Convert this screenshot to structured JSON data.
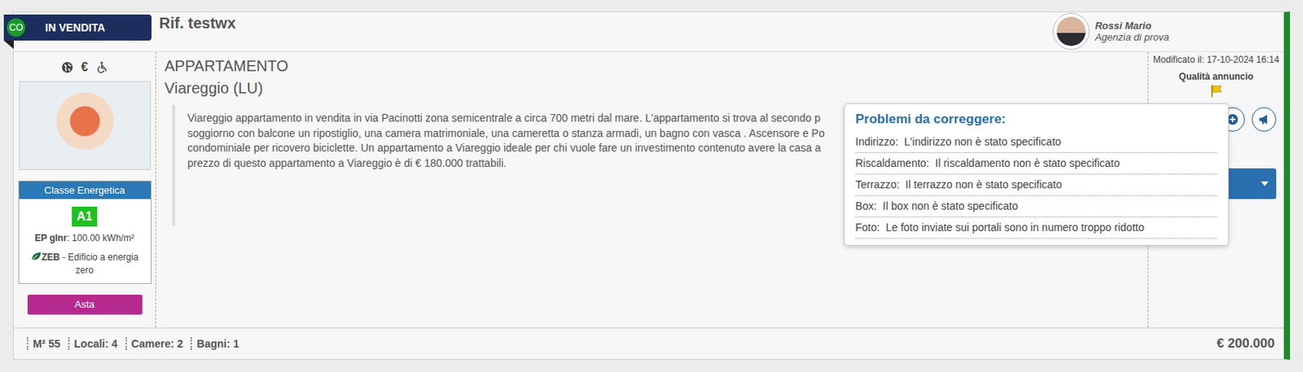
{
  "listing": {
    "status_badge": "CO",
    "status": "IN VENDITA",
    "reference": "Rif. testwx",
    "agent": {
      "name": "Rossi Mario",
      "agency": "Agenzia di prova"
    }
  },
  "left": {
    "currency_icon": "€",
    "energy": {
      "title": "Classe Energetica",
      "class": "A1",
      "ep_label": "EP glnr",
      "ep_value": ": 100.00 kWh/m²",
      "zeb_label": "ZEB",
      "zeb_text": "- Edificio a energia zero"
    },
    "auction_button": "Asta"
  },
  "property": {
    "type": "APPARTAMENTO",
    "location": "Viareggio (LU)",
    "description_lines": [
      "Viareggio appartamento in vendita in via Pacinotti zona semicentrale a circa 700 metri dal mare. L'appartamento si trova al secondo p",
      "soggiorno con balcone un ripostiglio, una camera matrimoniale, una cameretta o stanza armadi, un bagno con vasca . Ascensore e Po",
      "condominiale per ricovero biciclette. Un appartamento a Viareggio ideale per chi vuole fare un investimento contenuto avere la casa a",
      "prezzo di questo appartamento a Viareggio è di € 180.000 trattabili."
    ]
  },
  "side": {
    "modified": "Modificato il: 17-10-2024 16:14",
    "quality_label": "Qualità annuncio"
  },
  "tooltip": {
    "title": "Problemi da correggere:",
    "problems": [
      {
        "field": "Indirizzo:",
        "message": "L'indirizzo non è stato specificato"
      },
      {
        "field": "Riscaldamento:",
        "message": "Il riscaldamento non è stato specificato"
      },
      {
        "field": "Terrazzo:",
        "message": "Il terrazzo non è stato specificato"
      },
      {
        "field": "Box:",
        "message": "Il box non è stato specificato"
      },
      {
        "field": "Foto:",
        "message": "Le foto inviate sui portali sono in numero troppo ridotto"
      }
    ]
  },
  "footer": {
    "stats": [
      "M² 55",
      "Locali: 4",
      "Camere: 2",
      "Bagni: 1"
    ],
    "price": "€ 200.000"
  }
}
